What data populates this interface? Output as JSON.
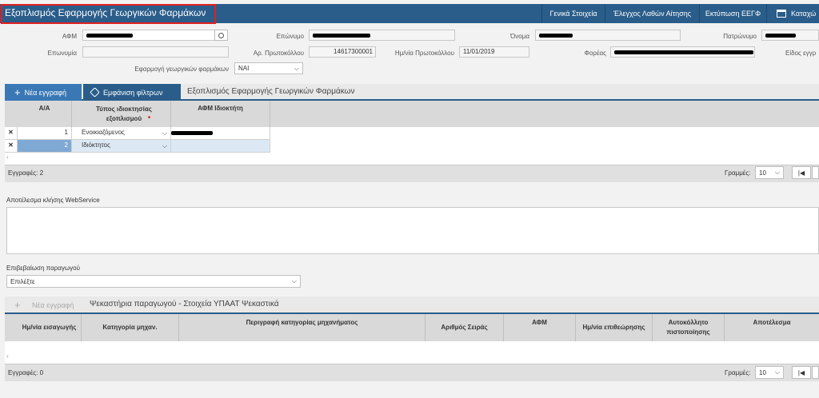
{
  "header": {
    "title": "Εξοπλισμός Εφαρμογής Γεωργικών Φαρμάκων",
    "buttons": [
      "Γενικά Στοιχεία",
      "Έλεγχος Λαθών Αίτησης",
      "Εκτύπωση ΕΕΓΦ",
      "Καταχώ"
    ]
  },
  "form": {
    "afm_label": "ΑΦΜ",
    "surname_label": "Επώνυμο",
    "name_label": "Όνομα",
    "fathername_label": "Πατρώνυμο",
    "company_label": "Επωνυμία",
    "protocol_no_label": "Αρ. Πρωτοκόλλου",
    "protocol_no_value": "14617300001",
    "protocol_date_label": "Ημ/νία Πρωτοκόλλου",
    "protocol_date_value": "11/01/2019",
    "agency_label": "Φορέας",
    "type_label": "Είδος εγγρ",
    "application_label": "Εφαρμογή γεωργικών φαρμάκων",
    "application_value": "ΝΑΙ"
  },
  "grid1": {
    "new_button": "Νέα εγγραφή",
    "filter_button": "Εμφάνιση φίλτρων",
    "tab_title": "Εξοπλισμός Εφαρμογής Γεωργικών Φαρμάκων",
    "columns": [
      "Α/Α",
      "Τύπος ιδιοκτησίας εξοπλισμού",
      "ΑΦΜ Ιδιοκτήτη"
    ],
    "rows": [
      {
        "aa": "1",
        "type": "Ενοικιαζόμενος"
      },
      {
        "aa": "2",
        "type": "Ιδιόκτητος"
      }
    ],
    "records_label": "Εγγραφές: 2",
    "lines_label": "Γραμμές:",
    "lines_value": "10"
  },
  "webservice": {
    "label": "Αποτέλεσμα κλήσης WebService"
  },
  "producer": {
    "label": "Επιβεβαίωση παραγωγού",
    "value": "Επιλέξτε"
  },
  "grid2": {
    "new_button": "Νέα εγγραφή",
    "tab_title": "Ψεκαστήρια παραγωγού - Στοιχεία ΥΠΑΑΤ Ψεκαστικά",
    "columns": [
      "Ημ/νία εισαγωγής",
      "Κατηγορία μηχαν.",
      "Περιγραφή κατηγορίας μηχανήματος",
      "Αριθμός Σειράς",
      "ΑΦΜ",
      "Ημ/νία επιθεώρησης",
      "Αυτοκόλλητο πιστοποίησης",
      "Αποτέλεσμα"
    ],
    "records_label": "Εγγραφές: 0",
    "lines_label": "Γραμμές:",
    "lines_value": "10"
  }
}
